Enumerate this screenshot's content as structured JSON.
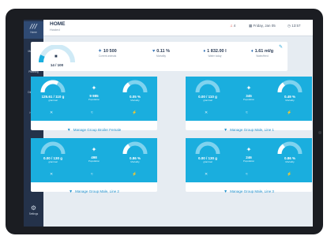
{
  "header": {
    "title": "HOME",
    "subtitle": "Hosted",
    "notifications": "4",
    "date": "Friday, Jan 05",
    "time": "13:57"
  },
  "sidebar": {
    "logo": "///",
    "items": [
      {
        "label": "Home",
        "icon": "logo-icon"
      },
      {
        "label": "Main Bins",
        "icon": "bins-icon"
      },
      {
        "label": "Planning",
        "icon": "planning-icon"
      },
      {
        "label": "Direct Ctrl",
        "icon": "control-icon"
      },
      {
        "label": "History",
        "icon": "history-icon"
      },
      {
        "label": "Settings",
        "icon": "gear-icon"
      }
    ]
  },
  "summary": {
    "gauge_value": "14 / 100",
    "gauge_level": 0.14,
    "stats": [
      {
        "value": "10 500",
        "label": "Current animals",
        "icon": "bird-icon"
      },
      {
        "value": "0.11 %",
        "label": "Mortality",
        "icon": "mortality-icon"
      },
      {
        "value": "1 832.00 l",
        "label": "Water today",
        "icon": "water-icon"
      },
      {
        "value": "1.61 ml/g",
        "label": "Water/feed",
        "icon": "water-feed-icon"
      }
    ]
  },
  "cards": [
    {
      "left_value": "125.61 / 110 g",
      "left_label": "g/animal",
      "left_level": 0.65,
      "middle_value": "9 985",
      "middle_label": "Population",
      "right_value": "0.05 %",
      "right_label": "Mortality",
      "right_level": 0.3,
      "footer": "Manage Group Broiler Female"
    },
    {
      "left_value": "0.00 / 110 g",
      "left_label": "g/animal",
      "left_level": 0.0,
      "middle_value": "345",
      "middle_label": "Population",
      "right_value": "0.49 %",
      "right_label": "Mortality",
      "right_level": 0.3,
      "footer": "Manage Group Male, Line 1"
    },
    {
      "left_value": "0.00 / 130 g",
      "left_label": "g/animal",
      "left_level": 0.0,
      "middle_value": "498",
      "middle_label": "Population",
      "right_value": "0.86 %",
      "right_label": "Mortality",
      "right_level": 0.3,
      "footer": "Manage Group Male, Line 2"
    },
    {
      "left_value": "0.00 / 130 g",
      "left_label": "g/animal",
      "left_level": 0.0,
      "middle_value": "246",
      "middle_label": "Population",
      "right_value": "0.86 %",
      "right_label": "Mortality",
      "right_level": 0.3,
      "footer": "Manage Group Male, Line 3"
    }
  ]
}
